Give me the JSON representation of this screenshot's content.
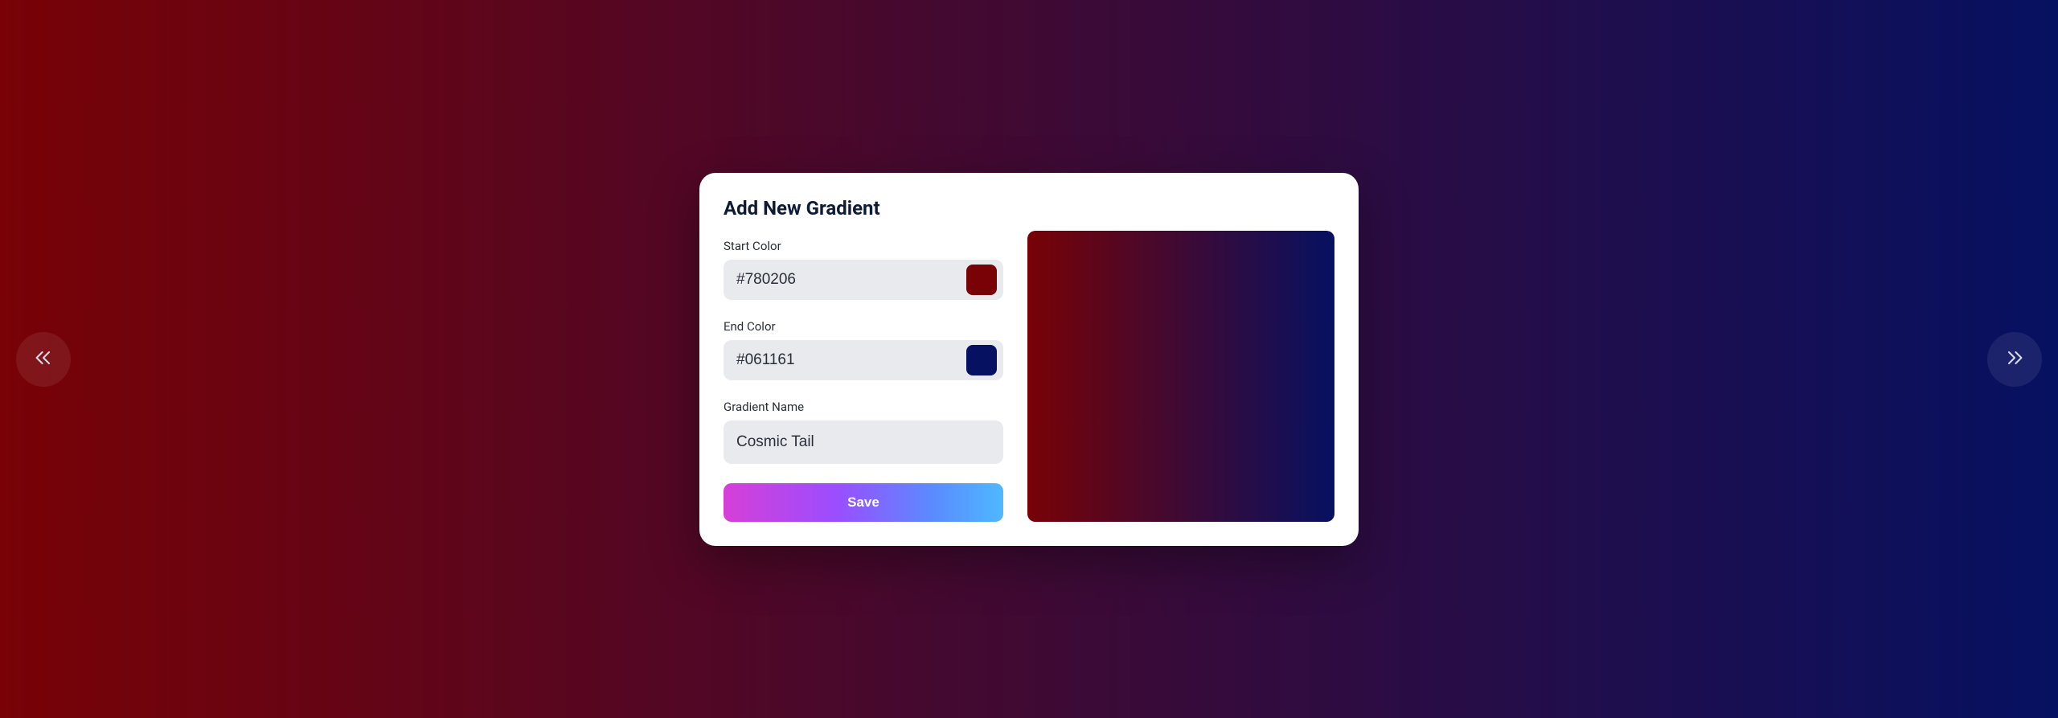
{
  "gradient": {
    "start_color": "#780206",
    "end_color": "#061161"
  },
  "form": {
    "title": "Add New Gradient",
    "labels": {
      "start": "Start Color",
      "end": "End Color",
      "name": "Gradient Name"
    },
    "values": {
      "start": "#780206",
      "end": "#061161",
      "name": "Cosmic Tail"
    },
    "save_label": "Save"
  }
}
